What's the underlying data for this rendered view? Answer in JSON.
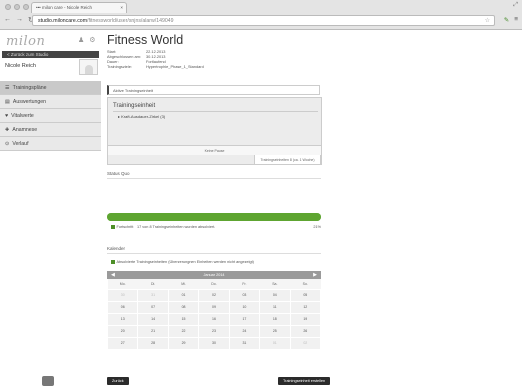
{
  "browser": {
    "tab_title": "••• milon care - Nicole Reich",
    "tab_close": "×",
    "url_host": "studio.miloncare.com",
    "url_path": "/fitnessworld/user/snjns/alarw/149049"
  },
  "sidebar": {
    "logo": "milon",
    "back_label": "< Zurück zum Studio",
    "user_name": "Nicole Reich",
    "menu": [
      {
        "label": "Trainingspläne",
        "icon": "list-icon"
      },
      {
        "label": "Auswertungen",
        "icon": "chart-icon"
      },
      {
        "label": "Vitalwerte",
        "icon": "heart-icon"
      },
      {
        "label": "Anamnese",
        "icon": "medical-icon"
      },
      {
        "label": "Verlauf",
        "icon": "history-icon"
      }
    ]
  },
  "main": {
    "title": "Fitness World",
    "info": [
      {
        "k": "Start:",
        "v": "22.12.2013"
      },
      {
        "k": "Abgeschlossen am:",
        "v": "30.12.2013"
      },
      {
        "k": "Dauer:",
        "v": "Fortlaufend"
      },
      {
        "k": "Trainingsziele:",
        "v": "Hypertrophie_Phase_1_Standard"
      }
    ],
    "active_unit_label": "Aktive Trainingseinheit",
    "unit_title": "Trainingseinheit",
    "unit_item": "Kraft-Ausdauer-Zirkel (3)",
    "pause_label": "Keine Pause",
    "unit_count": "Trainingseinheiten 8 (ca. 1 Woche)",
    "status_header": "Status Quo",
    "progress": {
      "value": 1.0
    },
    "progress_label": "Fortschritt",
    "progress_text": "17 von 8 Trainingseinheiten wurden absolviert.",
    "progress_pct": "21%",
    "calendar_header": "Kalender",
    "calendar_note": "Absolvierte Trainingseinheiten (Überzerungnen Einheiten werden nicht angezeigt)",
    "calendar": {
      "month": "Januar 2014",
      "prev": "◀",
      "next": "▶",
      "weekdays": [
        "Mo.",
        "Di.",
        "Mi.",
        "Do.",
        "Fr.",
        "Sa.",
        "So."
      ],
      "weeks": [
        [
          "30",
          "31",
          "01",
          "02",
          "03",
          "04",
          "05"
        ],
        [
          "06",
          "07",
          "08",
          "09",
          "10",
          "11",
          "12"
        ],
        [
          "13",
          "14",
          "15",
          "16",
          "17",
          "18",
          "19"
        ],
        [
          "20",
          "21",
          "22",
          "23",
          "24",
          "25",
          "26"
        ],
        [
          "27",
          "28",
          "29",
          "30",
          "31",
          "01",
          "02"
        ]
      ]
    },
    "back_button": "Zurück",
    "create_button": "Trainingseinheit erstellen"
  }
}
